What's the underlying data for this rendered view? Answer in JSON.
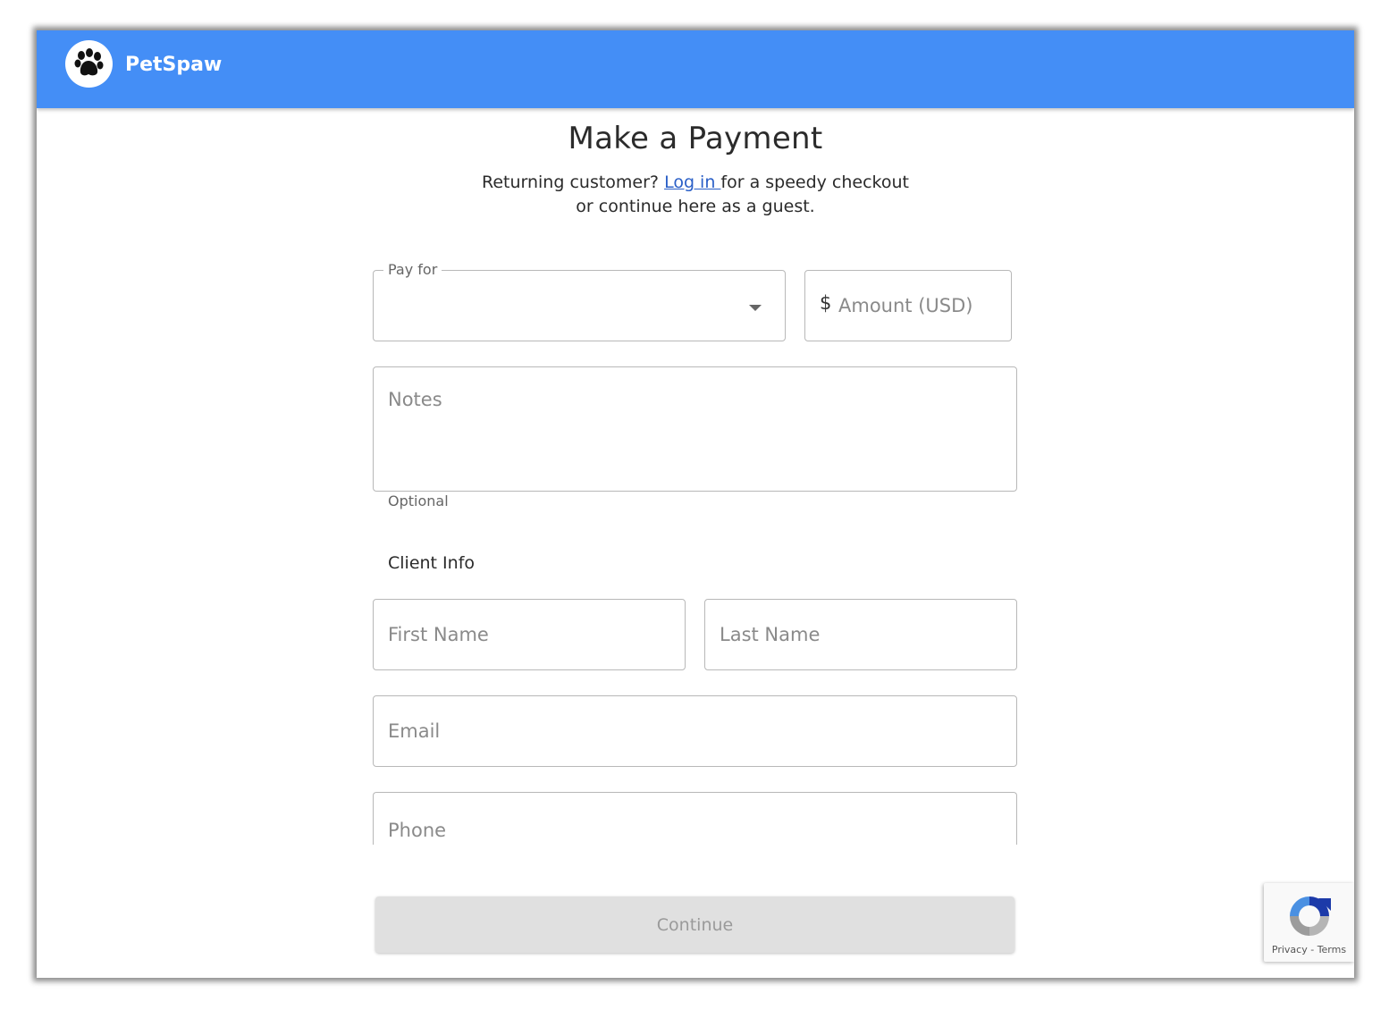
{
  "header": {
    "brand": "PetSpaw",
    "logo_icon": "paw-icon",
    "background": "#448ef6"
  },
  "main": {
    "title": "Make a Payment",
    "subtitle_prefix": "Returning customer? ",
    "login_link": "Log in ",
    "subtitle_suffix": "for a speedy checkout",
    "subtitle_line2": "or continue here as a guest."
  },
  "form": {
    "pay_for": {
      "label": "Pay for",
      "value": ""
    },
    "amount": {
      "prefix": "$",
      "placeholder": "Amount (USD)"
    },
    "notes": {
      "placeholder": "Notes",
      "helper": "Optional"
    },
    "client_info_label": "Client Info",
    "first_name": {
      "placeholder": "First Name"
    },
    "last_name": {
      "placeholder": "Last Name"
    },
    "email": {
      "placeholder": "Email"
    },
    "phone": {
      "placeholder": "Phone"
    },
    "continue_label": "Continue"
  },
  "recaptcha": {
    "privacy": "Privacy",
    "separator": " - ",
    "terms": "Terms"
  }
}
